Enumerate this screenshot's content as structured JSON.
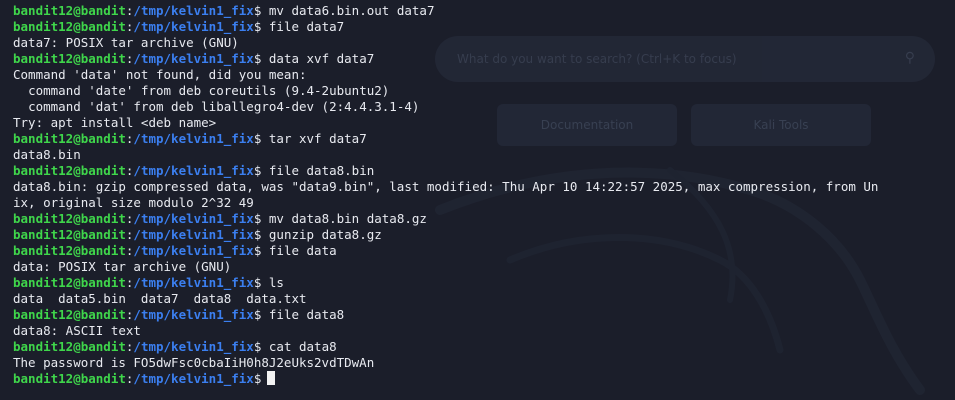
{
  "background": {
    "search_placeholder": "What do you want to search? (Ctrl+K to focus)",
    "search_icon": "search-icon",
    "docs_label": "Documentation",
    "tools_label": "Kali Tools"
  },
  "colors": {
    "background": "#1b1e2a",
    "prompt_user": "#3fd64b",
    "prompt_path": "#3b7ff0",
    "text": "#e8eaf0"
  },
  "prompt": {
    "user": "bandit12@bandit",
    "path": "/tmp/kelvin1_fix",
    "symbol": "$"
  },
  "lines": [
    {
      "type": "prompt",
      "cmd": "mv data6.bin.out data7"
    },
    {
      "type": "prompt",
      "cmd": "file data7"
    },
    {
      "type": "output",
      "text": "data7: POSIX tar archive (GNU)"
    },
    {
      "type": "prompt",
      "cmd": "data xvf data7"
    },
    {
      "type": "output",
      "text": "Command 'data' not found, did you mean:"
    },
    {
      "type": "output",
      "text": "  command 'date' from deb coreutils (9.4-2ubuntu2)"
    },
    {
      "type": "output",
      "text": "  command 'dat' from deb liballegro4-dev (2:4.4.3.1-4)"
    },
    {
      "type": "output",
      "text": "Try: apt install <deb name>"
    },
    {
      "type": "prompt",
      "cmd": "tar xvf data7"
    },
    {
      "type": "output",
      "text": "data8.bin"
    },
    {
      "type": "prompt",
      "cmd": "file data8.bin"
    },
    {
      "type": "output",
      "text": "data8.bin: gzip compressed data, was \"data9.bin\", last modified: Thu Apr 10 14:22:57 2025, max compression, from Un"
    },
    {
      "type": "output",
      "text": "ix, original size modulo 2^32 49"
    },
    {
      "type": "prompt",
      "cmd": "mv data8.bin data8.gz"
    },
    {
      "type": "prompt",
      "cmd": "gunzip data8.gz"
    },
    {
      "type": "prompt",
      "cmd": "file data"
    },
    {
      "type": "output",
      "text": "data: POSIX tar archive (GNU)"
    },
    {
      "type": "prompt",
      "cmd": "ls"
    },
    {
      "type": "output",
      "text": "data  data5.bin  data7  data8  data.txt"
    },
    {
      "type": "prompt",
      "cmd": "file data8"
    },
    {
      "type": "output",
      "text": "data8: ASCII text"
    },
    {
      "type": "prompt",
      "cmd": "cat data8"
    },
    {
      "type": "output",
      "text": "The password is FO5dwFsc0cbaIiH0h8J2eUks2vdTDwAn"
    },
    {
      "type": "prompt",
      "cmd": "",
      "cursor": true
    }
  ]
}
